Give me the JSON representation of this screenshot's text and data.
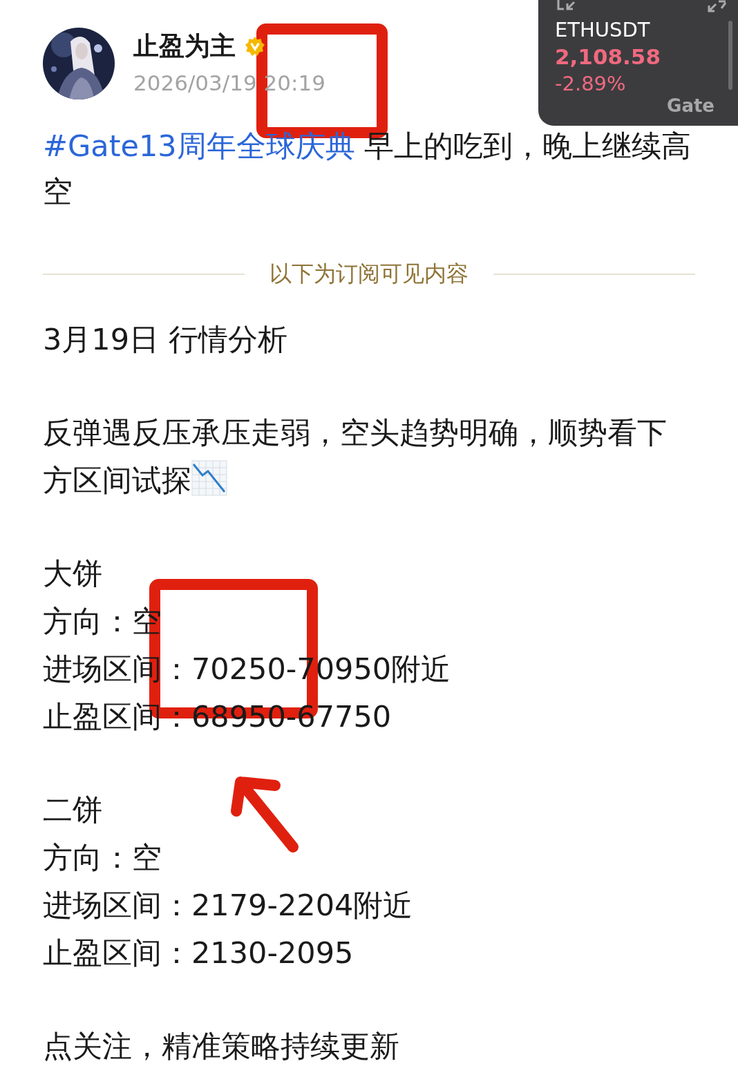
{
  "author": {
    "name": "止盈为主",
    "verified": true,
    "timestamp": "2026/03/19 20:19"
  },
  "post": {
    "hashtag": "#Gate13周年全球庆典",
    "text": " 早上的吃到，晚上继续高空"
  },
  "divider_label": "以下为订阅可见内容",
  "blocks": [
    {
      "lines": [
        {
          "text": "3月19日 行情分析",
          "trend_chart": false
        }
      ]
    },
    {
      "lines": [
        {
          "text": "反弹遇反压承压走弱，空头趋势明确，顺势看下方区间试探",
          "trend_chart": true
        }
      ]
    },
    {
      "lines": [
        {
          "text": "大饼",
          "trend_chart": false
        },
        {
          "text": "方向：空",
          "trend_chart": false
        },
        {
          "text": "进场区间：70250-70950附近",
          "trend_chart": false
        },
        {
          "text": "止盈区间：68950-67750",
          "trend_chart": false
        }
      ]
    },
    {
      "lines": [
        {
          "text": "二饼",
          "trend_chart": false
        },
        {
          "text": "方向：空",
          "trend_chart": false
        },
        {
          "text": "进场区间：2179-2204附近",
          "trend_chart": false
        },
        {
          "text": "止盈区间：2130-2095",
          "trend_chart": false
        }
      ]
    },
    {
      "lines": [
        {
          "text": "点关注，精准策略持续更新",
          "trend_chart": false
        }
      ]
    }
  ],
  "ticker": {
    "symbol": "ETHUSDT",
    "price": "2,108.58",
    "change": "-2.89%",
    "falling": true,
    "brand": "Gate"
  },
  "annotations": [
    {
      "kind": "frame"
    },
    {
      "kind": "frame"
    },
    {
      "kind": "arrow"
    }
  ]
}
